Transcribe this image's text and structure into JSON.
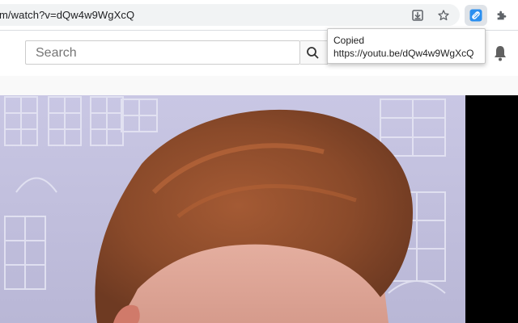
{
  "browser": {
    "url_prefix": "m/watch?v=dQw4w9WgXcQ",
    "icons": [
      "download-icon",
      "star-icon",
      "extension-copy-icon",
      "puzzle-icon"
    ]
  },
  "tooltip": {
    "title": "Copied",
    "link": "https://youtu.be/dQw4w9WgXcQ"
  },
  "page": {
    "search_placeholder": "Search",
    "icons": [
      "search-icon",
      "bell-icon"
    ]
  },
  "colors": {
    "accent": "#1a73e8",
    "video_bg": "#000000"
  }
}
